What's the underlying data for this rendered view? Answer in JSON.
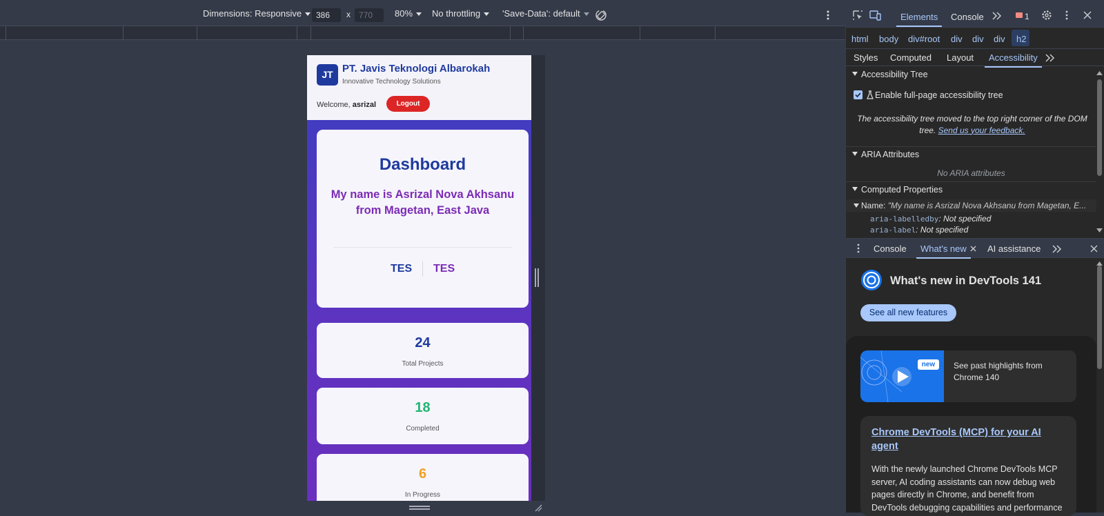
{
  "device_toolbar": {
    "dimensions_label": "Dimensions: Responsive",
    "width_value": "386",
    "times": "x",
    "height_placeholder": "770",
    "zoom": "80%",
    "throttling": "No throttling",
    "save_data": "'Save-Data': default"
  },
  "app": {
    "logo_initials": "JT",
    "company_name": "PT. Javis Teknologi Albarokah",
    "tagline": "Innovative Technology Solutions",
    "welcome_prefix": "Welcome, ",
    "username": "asrizal",
    "logout_label": "Logout",
    "dashboard_title": "Dashboard",
    "intro_text": "My name is Asrizal Nova Akhsanu from Magetan, East Java",
    "tag_left": "TES",
    "tag_right": "TES",
    "stats": [
      {
        "value": "24",
        "label": "Total Projects",
        "color": "#1e3a9e"
      },
      {
        "value": "18",
        "label": "Completed",
        "color": "#22b573"
      },
      {
        "value": "6",
        "label": "In Progress",
        "color": "#f0a020"
      }
    ]
  },
  "devtools": {
    "top_tabs": [
      "Elements",
      "Console"
    ],
    "issues_count": "1",
    "breadcrumbs": [
      "html",
      "body",
      "div#root",
      "div",
      "div",
      "div",
      "h2"
    ],
    "sub_tabs": [
      "Styles",
      "Computed",
      "Layout",
      "Accessibility"
    ],
    "accessibility_tree_label": "Accessibility Tree",
    "enable_tree_label": "Enable full-page accessibility tree",
    "tree_moved_text": "The accessibility tree moved to the top right corner of the DOM tree.",
    "feedback_link": "Send us your feedback.",
    "aria_attributes_label": "ARIA Attributes",
    "no_aria": "No ARIA attributes",
    "computed_properties_label": "Computed Properties",
    "name_key": "Name: ",
    "name_value": "\"My name is Asrizal Nova Akhsanu from Magetan, E...",
    "aria_labelledby_key": "aria-labelledby",
    "aria_labelledby_value": ": Not specified",
    "aria_label_key": "aria-label",
    "aria_label_value": ": Not specified",
    "drawer_tabs": [
      "Console",
      "What's new",
      "AI assistance"
    ],
    "whats_new_title": "What's new in DevTools 141",
    "see_all_label": "See all new features",
    "new_badge": "new",
    "past_highlights": "See past highlights from Chrome 140",
    "article_title": "Chrome DevTools (MCP) for your AI agent",
    "article_body": "With the newly launched Chrome DevTools MCP server, AI coding assistants can now debug web pages directly in Chrome, and benefit from DevTools debugging capabilities and performance"
  }
}
